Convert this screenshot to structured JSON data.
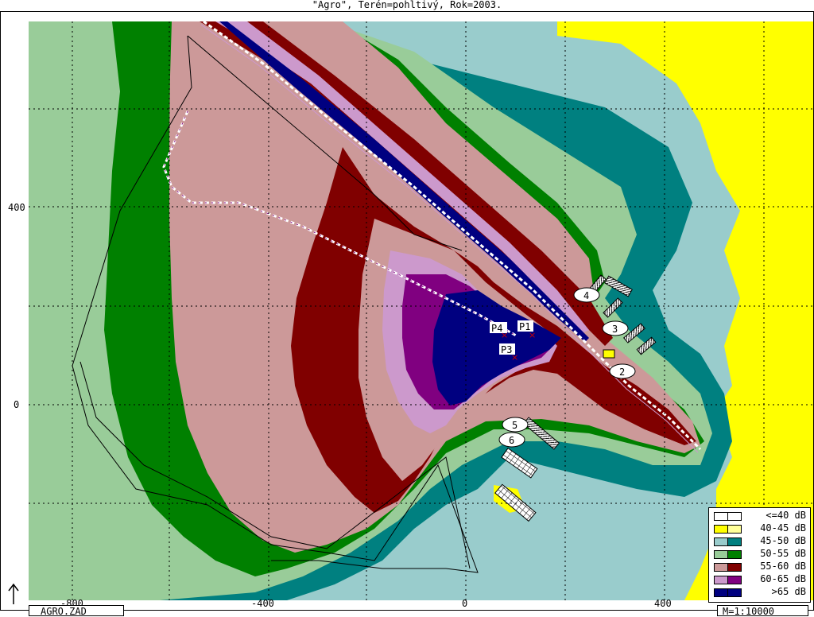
{
  "title": "\"Agro\", Terén=pohltivý, Rok=2003.",
  "axes": {
    "y_ticks": [
      "400",
      "0"
    ],
    "x_ticks": [
      "-800",
      "-400",
      "0",
      "400"
    ]
  },
  "labels": {
    "points": [
      "P1",
      "P3",
      "P4"
    ],
    "buildings": [
      "2",
      "3",
      "4",
      "5",
      "6"
    ]
  },
  "legend": [
    {
      "label": "<=40 dB",
      "color": "#ffffff",
      "color2": "#ffffff"
    },
    {
      "label": "40-45 dB",
      "color": "#ffff00",
      "color2": "#ffff99"
    },
    {
      "label": "45-50 dB",
      "color": "#99cccc",
      "color2": "#008080"
    },
    {
      "label": "50-55 dB",
      "color": "#99cc99",
      "color2": "#008000"
    },
    {
      "label": "55-60 dB",
      "color": "#cc9999",
      "color2": "#800000"
    },
    {
      "label": "60-65 dB",
      "color": "#cc99cc",
      "color2": "#800080"
    },
    {
      "label": ">65 dB",
      "color": "#000080",
      "color2": "#000080"
    }
  ],
  "file_name": "AGRO.ZAD",
  "scale": "M=1:10000",
  "colors": {
    "band_40_45": "#ffff00",
    "band_45_50_light": "#99cccc",
    "band_45_50_dark": "#008080",
    "band_50_55_light": "#99cc99",
    "band_50_55_dark": "#008000",
    "band_55_60_light": "#cc9999",
    "band_55_60_dark": "#800000",
    "band_60_65_light": "#cc99cc",
    "band_60_65_dark": "#800080",
    "band_over_65": "#000080"
  },
  "icons": {
    "north_arrow": "north-arrow-icon",
    "receiver": "receiver-cross-icon"
  }
}
